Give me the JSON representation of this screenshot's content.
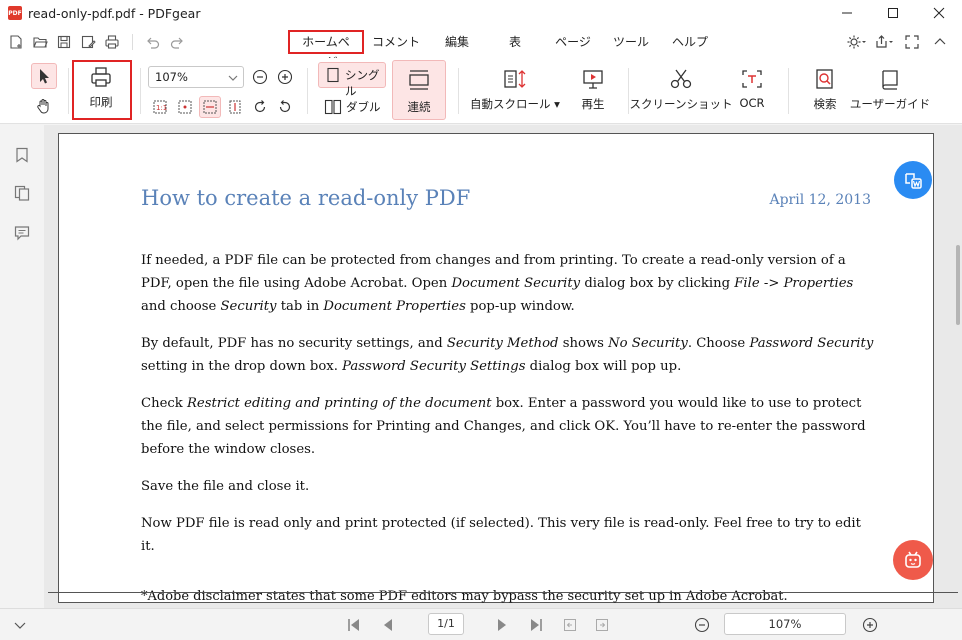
{
  "window": {
    "logo_text": "PDF",
    "title": "read-only-pdf.pdf - PDFgear"
  },
  "menu": {
    "tabs": [
      {
        "label": "ホームページ"
      },
      {
        "label": "コメント"
      },
      {
        "label": "編集"
      },
      {
        "label": "表"
      },
      {
        "label": "ページ"
      },
      {
        "label": "ツール"
      },
      {
        "label": "ヘルプ"
      }
    ]
  },
  "ribbon": {
    "print_label": "印刷",
    "zoom_value": "107%",
    "single_label": "シングル",
    "double_label": "ダブル",
    "continuous_label": "連続",
    "autoscroll_label": "自動スクロール",
    "play_label": "再生",
    "screenshot_label": "スクリーンショット",
    "ocr_label": "OCR",
    "search_label": "検索",
    "guide_label": "ユーザーガイド"
  },
  "document": {
    "title": "How to create a read-only PDF",
    "date": "April 12, 2013",
    "footnote": "*Adobe disclaimer states that some PDF editors may bypass the security set up in Adobe Acrobat."
  },
  "statusbar": {
    "page_indicator": "1/1",
    "zoom": "107%"
  },
  "colors": {
    "accent_red": "#e02424",
    "title_blue": "#5a82b8",
    "fab_blue": "#2a8bf2",
    "fab_red": "#ef5a4a",
    "selected_bg": "#fde5e5"
  },
  "icons": {
    "titlebar": [
      "app-logo",
      "minimize-icon",
      "maximize-icon",
      "close-icon"
    ],
    "quick_access": [
      "new-file-icon",
      "open-folder-icon",
      "save-icon",
      "save-as-icon",
      "print-icon",
      "undo-icon",
      "redo-icon"
    ],
    "menu_right": [
      "theme-icon",
      "share-icon",
      "fullscreen-icon",
      "collapse-ribbon-icon"
    ]
  }
}
